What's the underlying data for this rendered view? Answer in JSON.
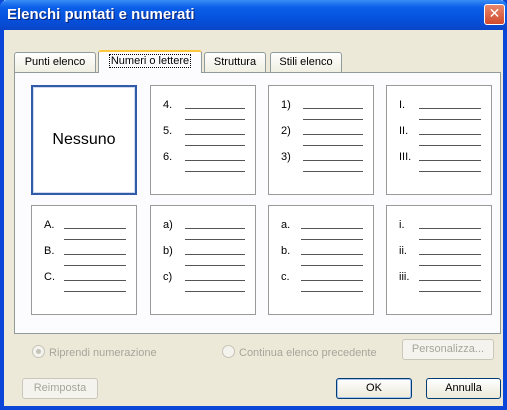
{
  "window": {
    "title": "Elenchi puntati e numerati",
    "close_glyph": "✕"
  },
  "tabs": [
    {
      "label": "Punti elenco",
      "active": false
    },
    {
      "label": "Numeri o lettere",
      "active": true
    },
    {
      "label": "Struttura",
      "active": false
    },
    {
      "label": "Stili elenco",
      "active": false
    }
  ],
  "styles": {
    "none_label": "Nessuno",
    "row1": [
      [
        "4.",
        "5.",
        "6."
      ],
      [
        "1)",
        "2)",
        "3)"
      ],
      [
        "I.",
        "II.",
        "III."
      ]
    ],
    "row2": [
      [
        "A.",
        "B.",
        "C."
      ],
      [
        "a)",
        "b)",
        "c)"
      ],
      [
        "a.",
        "b.",
        "c."
      ],
      [
        "i.",
        "ii.",
        "iii."
      ]
    ]
  },
  "options": {
    "restart_label": "Riprendi numerazione",
    "continue_label": "Continua elenco precedente",
    "customize_label": "Personalizza..."
  },
  "footer": {
    "reset_label": "Reimposta",
    "ok_label": "OK",
    "cancel_label": "Annulla"
  },
  "colors": {
    "titlebar": "#0553df",
    "selection_border": "#2f5ba8",
    "active_tab_highlight": "#ffc83c"
  }
}
